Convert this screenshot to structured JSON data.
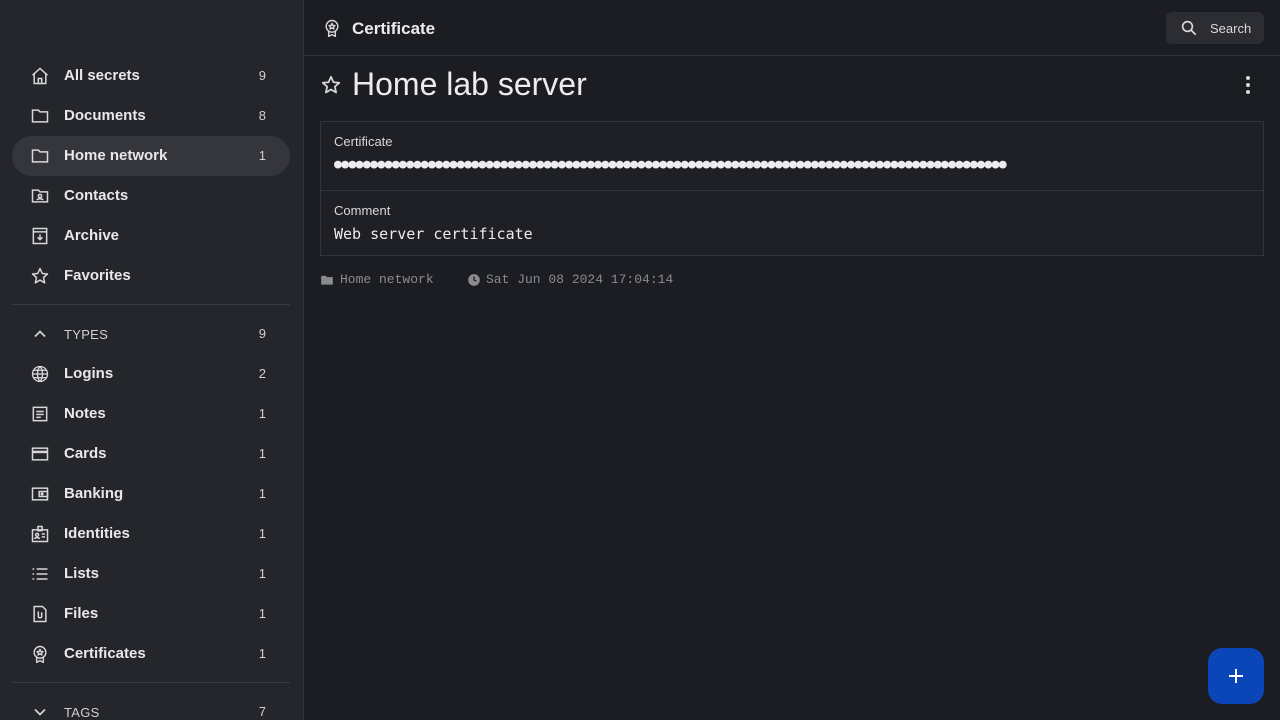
{
  "sidebar": {
    "items": [
      {
        "label": "All secrets",
        "count": "9",
        "icon": "home-icon"
      },
      {
        "label": "Documents",
        "count": "8",
        "icon": "folder-icon"
      },
      {
        "label": "Home network",
        "count": "1",
        "icon": "folder-icon"
      },
      {
        "label": "Contacts",
        "count": "",
        "icon": "contacts-folder-icon"
      },
      {
        "label": "Archive",
        "count": "",
        "icon": "archive-icon"
      },
      {
        "label": "Favorites",
        "count": "",
        "icon": "star-icon"
      }
    ],
    "types_header": {
      "label": "TYPES",
      "count": "9"
    },
    "types": [
      {
        "label": "Logins",
        "count": "2",
        "icon": "globe-icon"
      },
      {
        "label": "Notes",
        "count": "1",
        "icon": "note-icon"
      },
      {
        "label": "Cards",
        "count": "1",
        "icon": "card-icon"
      },
      {
        "label": "Banking",
        "count": "1",
        "icon": "wallet-icon"
      },
      {
        "label": "Identities",
        "count": "1",
        "icon": "id-badge-icon"
      },
      {
        "label": "Lists",
        "count": "1",
        "icon": "list-icon"
      },
      {
        "label": "Files",
        "count": "1",
        "icon": "file-attachment-icon"
      },
      {
        "label": "Certificates",
        "count": "1",
        "icon": "certificate-icon"
      }
    ],
    "tags_header": {
      "label": "TAGS",
      "count": "7"
    }
  },
  "topbar": {
    "title": "Certificate",
    "search_label": "Search"
  },
  "entry": {
    "title": "Home lab server",
    "fields": [
      {
        "label": "Certificate",
        "value": "●●●●●●●●●●●●●●●●●●●●●●●●●●●●●●●●●●●●●●●●●●●●●●●●●●●●●●●●●●●●●●●●●●●●●●●●●●●●●●●●●●●●●●●●●●●●●"
      },
      {
        "label": "Comment",
        "value": "Web server certificate"
      }
    ],
    "folder": "Home network",
    "modified": "Sat Jun 08 2024 17:04:14"
  },
  "colors": {
    "accent": "#0b46b8",
    "sidebar_bg": "#25262b",
    "main_bg": "#1c1d22"
  }
}
